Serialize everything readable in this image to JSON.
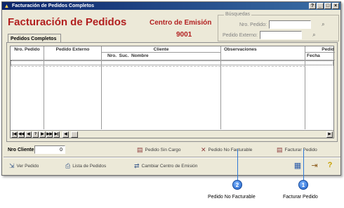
{
  "window": {
    "title": "Facturación  de Pedidos Completos",
    "controls": [
      "?",
      "_",
      "□",
      "×"
    ]
  },
  "header": {
    "title": "Facturación de Pedidos",
    "centro_label": "Centro de Emisión",
    "centro_value": "9001"
  },
  "busquedas": {
    "legend": "Búsquedas",
    "nro_pedido_label": "Nro. Pedido:",
    "nro_pedido_value": "",
    "pedido_externo_label": "Pedido Externo:",
    "pedido_externo_value": ""
  },
  "tab": {
    "label": "Pedidos Completos"
  },
  "grid": {
    "col_nro_pedido": "Nro. Pedido",
    "col_pedido_externo": "Pedido Externo",
    "col_cliente": "Cliente",
    "col_cliente_sub_nro": "Nro.",
    "col_cliente_sub_suc": "Suc.",
    "col_cliente_sub_nombre": "Nombre",
    "col_observaciones": "Observaciones",
    "col_pedido": "Pedid",
    "col_pedido_sub_fecha": "Fecha"
  },
  "navbar": {
    "first": "|◀",
    "prev_page": "◀◀",
    "prev": "◀",
    "page": "?",
    "next": "▶",
    "next_page": "▶▶",
    "last": "▶|"
  },
  "footer": {
    "nro_cliente_label": "Nro Cliente:",
    "nro_cliente_value": "0",
    "pedido_sin_cargo": "Pedido Sin Cargo",
    "pedido_no_facturable": "Pedido No Facturable",
    "facturar_pedido": "Facturar Pedido",
    "ver_pedido": "Ver Pedido",
    "lista_de_pedidos": "Lista de Pedidos",
    "cambiar_centro": "Cambiar Centro de Emisión"
  },
  "callouts": {
    "badge1": "1",
    "badge1_label": "Facturar Pedido",
    "badge2": "2",
    "badge2_label": "Pedido No Facturable"
  },
  "colors": {
    "title_red": "#b22020",
    "titlebar_blue": "#0a246a",
    "callout_blue": "#1f5fc6"
  }
}
